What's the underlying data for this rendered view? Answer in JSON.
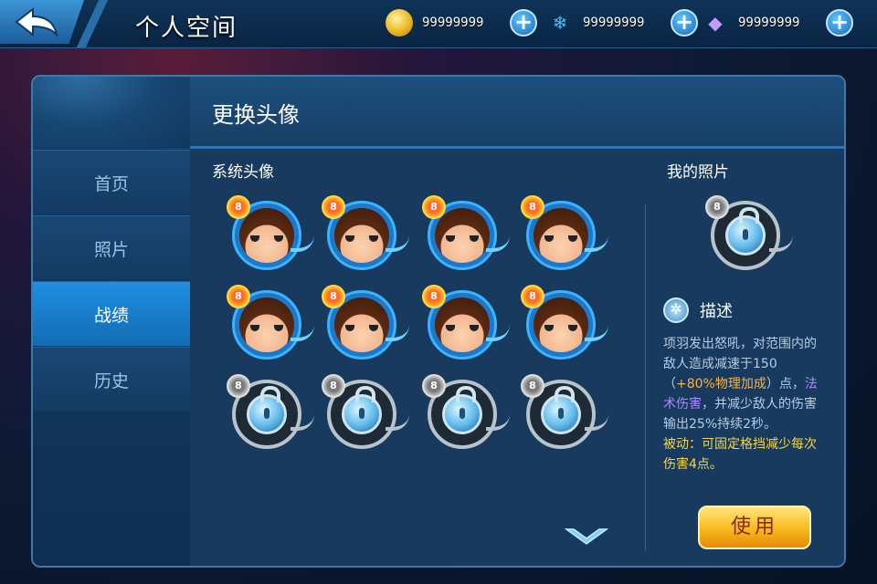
{
  "header": {
    "title": "个人空间"
  },
  "currencies": [
    {
      "icon": "gold-coin-icon",
      "value": "99999999"
    },
    {
      "icon": "snowflake-icon",
      "value": "99999999"
    },
    {
      "icon": "diamond-icon",
      "value": "99999999"
    }
  ],
  "sidebar": {
    "items": [
      {
        "label": "首页"
      },
      {
        "label": "照片"
      },
      {
        "label": "战绩"
      },
      {
        "label": "历史"
      }
    ],
    "active": "战绩"
  },
  "content": {
    "title": "更换头像",
    "system_label": "系统头像",
    "my_photo_label": "我的照片"
  },
  "avatar_badge": "8",
  "description": {
    "title": "描述",
    "line1": "项羽发出怒吼，对范围内的敌人造成减速于150（",
    "bonus": "+80%物理加成",
    "line2": "）点，",
    "magic": "法术伤害",
    "line3": "，并减少敌人的伤害输出25%持续2秒。",
    "passive": "被动：可固定格挡减少每次伤害4点。"
  },
  "use_button": "使用",
  "colors": {
    "accent": "#1f8fe0",
    "gold": "#f7b91c",
    "orange_text": "#ffb23a",
    "purple_text": "#a88bff",
    "yellow_text": "#f7d63c"
  }
}
